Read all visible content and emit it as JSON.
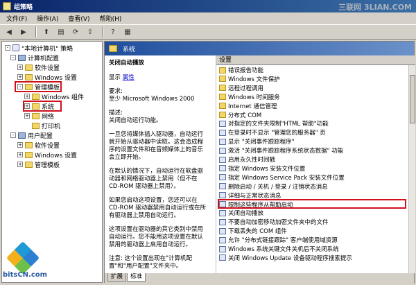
{
  "window": {
    "title": "组策略",
    "watermark": "三联网 3LIAN.COM"
  },
  "menu": [
    "文件(F)",
    "操作(A)",
    "查看(V)",
    "帮助(H)"
  ],
  "tree": [
    {
      "label": "\"本地计算机\" 策略",
      "level": 0,
      "icon": "policy-icon",
      "toggle": "-"
    },
    {
      "label": "计算机配置",
      "level": 1,
      "icon": "computer-icon",
      "toggle": "-"
    },
    {
      "label": "软件设置",
      "level": 2,
      "icon": "folder-icon",
      "toggle": "+"
    },
    {
      "label": "Windows 设置",
      "level": 2,
      "icon": "folder-icon",
      "toggle": "+"
    },
    {
      "label": "管理模板",
      "level": 2,
      "icon": "folder-icon",
      "toggle": "-",
      "highlighted": true
    },
    {
      "label": "Windows 组件",
      "level": 3,
      "icon": "folder-icon",
      "toggle": "+"
    },
    {
      "label": "系统",
      "level": 3,
      "icon": "folder-icon",
      "toggle": "+",
      "highlighted": true
    },
    {
      "label": "网络",
      "level": 3,
      "icon": "folder-icon",
      "toggle": "+"
    },
    {
      "label": "打印机",
      "level": 3,
      "icon": "folder-icon",
      "toggle": ""
    },
    {
      "label": "用户配置",
      "level": 1,
      "icon": "computer-icon",
      "toggle": "-"
    },
    {
      "label": "软件设置",
      "level": 2,
      "icon": "folder-icon",
      "toggle": "+"
    },
    {
      "label": "Windows 设置",
      "level": 2,
      "icon": "folder-icon",
      "toggle": "+"
    },
    {
      "label": "管理模板",
      "level": 2,
      "icon": "folder-icon",
      "toggle": "+"
    }
  ],
  "right": {
    "header": "系统",
    "desc": {
      "title": "关闭自动播放",
      "show_label": "显示",
      "properties_link": "属性",
      "requirement_label": "要求:",
      "requirement": "至少 Microsoft Windows 2000",
      "description_label": "描述:",
      "p1": "关闭自动运行功能。",
      "p2": "一旦您将媒体插入驱动器，自动运行就开始从驱动器中读取。这会造成程序的设置文件和在音频媒体上的音乐会立即开始。",
      "p3": "在默认的情况下，自动运行在软盘驱动器和网络驱动器上禁用（但不在 CD-ROM 驱动器上禁用）。",
      "p4": "如果您启动这项设置，您还可以在 CD-ROM 驱动器禁用自动运行或在所有驱动器上禁用自动运行。",
      "p5": "这项设置在驱动器的其它类别中禁用自动运行。您不能用这项设置在默认禁用的驱动器上启用自动运行。",
      "p6": "注意: 这个设置出现在\"计算机配置\"和\"用户配置\"文件夹中。"
    },
    "column_header": "设置",
    "items": [
      {
        "label": "错误报告功能",
        "icon": "folder"
      },
      {
        "label": "Windows 文件保护",
        "icon": "folder"
      },
      {
        "label": "远程过程调用",
        "icon": "folder"
      },
      {
        "label": "Windows 时间服务",
        "icon": "folder"
      },
      {
        "label": "Internet 通信管理",
        "icon": "folder"
      },
      {
        "label": "分布式 COM",
        "icon": "folder"
      },
      {
        "label": "对指定的文件夹限制\"HTML 帮助\"功能",
        "icon": "setting"
      },
      {
        "label": "在登录时不显示 \"管理您的服务器\" 页",
        "icon": "setting"
      },
      {
        "label": "显示 \"关闭事件跟踪程序\"",
        "icon": "setting"
      },
      {
        "label": "激活 \"关闭事件跟踪程序系统状态数据\" 功能",
        "icon": "setting"
      },
      {
        "label": "启用永久性时间戳",
        "icon": "setting"
      },
      {
        "label": "指定 Windows 安装文件位置",
        "icon": "setting"
      },
      {
        "label": "指定 Windows Service Pack 安装文件位置",
        "icon": "setting"
      },
      {
        "label": "删除启动 / 关机 / 登录 / 注销状态消息",
        "icon": "setting"
      },
      {
        "label": "详细与正常状态消息",
        "icon": "setting"
      },
      {
        "label": "限制这些程序从帮助启动",
        "icon": "setting"
      },
      {
        "label": "关闭自动播放",
        "icon": "setting",
        "highlighted": true
      },
      {
        "label": "不要自动加密移动加密文件夹中的文件",
        "icon": "setting"
      },
      {
        "label": "下载丢失的 COM 组件",
        "icon": "setting"
      },
      {
        "label": "允许 \"分布式链接跟踪\" 客户端使用域资源",
        "icon": "setting"
      },
      {
        "label": "Windows 系统关键文件关机后不关闭系统",
        "icon": "setting"
      },
      {
        "label": "关闭 Windows Update 设备驱动程序搜索提示",
        "icon": "setting"
      }
    ],
    "tabs": [
      "扩展",
      "标准"
    ]
  },
  "brand": {
    "name": "bitsCN.com"
  },
  "colors": {
    "highlight_border": "#d0101a",
    "header_gradient_start": "#1f4e9c",
    "link": "#0000cc"
  }
}
